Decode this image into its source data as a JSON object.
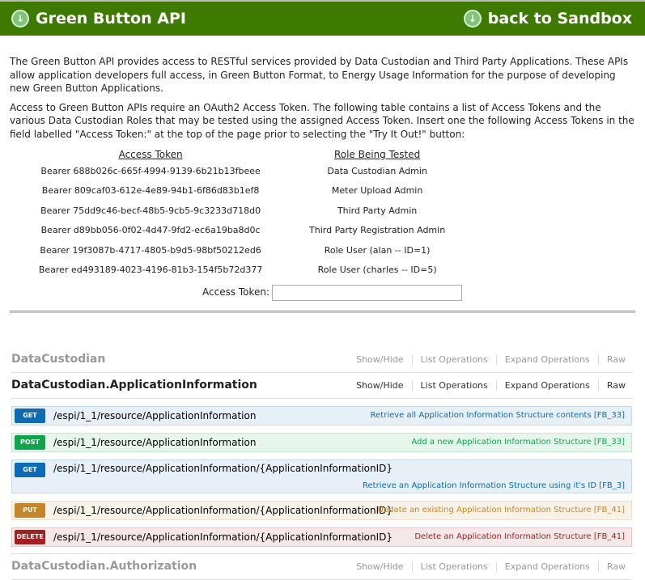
{
  "header": {
    "title": "Green Button API",
    "back_link": "back to Sandbox"
  },
  "intro": {
    "p1": "The Green Button API provides access to RESTful services provided by Data Custodian and Third Party Applications. These APIs allow application developers full access, in Green Button Format, to Energy Usage Information for the purpose of developing new Green Button Applications.",
    "p2": "Access to Green Button APIs require an OAuth2 Access Token. The following table contains a list of Access Tokens and the various Data Custodian Roles that may be tested using the assigned Access Token. Insert one the following Access Tokens in the field labelled \"Access Token:\" at the top of the page prior to selecting the \"Try It Out!\" button:"
  },
  "tokens": {
    "headers": [
      "Access Token",
      "Role Being Tested"
    ],
    "rows": [
      [
        "Bearer 688b026c-665f-4994-9139-6b21b13fbeee",
        "Data Custodian Admin"
      ],
      [
        "Bearer 809caf03-612e-4e89-94b1-6f86d83b1ef8",
        "Meter Upload Admin"
      ],
      [
        "Bearer 75dd9c46-becf-48b5-9cb5-9c3233d718d0",
        "Third Party Admin"
      ],
      [
        "Bearer d89bb056-0f02-4d47-9fd2-ec6a19ba8d0c",
        "Third Party Registration Admin"
      ],
      [
        "Bearer 19f3087b-4717-4805-b9d5-98bf50212ed6",
        "Role User (alan -- ID=1)"
      ],
      [
        "Bearer ed493189-4023-4196-81b3-154f5b72d377",
        "Role User (charles -- ID=5)"
      ]
    ],
    "input_label": "Access Token:",
    "input_value": ""
  },
  "links": [
    "Show/Hide",
    "List Operations",
    "Expand Operations",
    "Raw"
  ],
  "resources": [
    {
      "name": "DataCustodian"
    },
    {
      "name": "DataCustodian.ApplicationInformation",
      "ops": [
        {
          "method": "GET",
          "path": "/espi/1_1/resource/ApplicationInformation",
          "summary": "Retrieve all Application Information Structure contents [FB_33]"
        },
        {
          "method": "POST",
          "path": "/espi/1_1/resource/ApplicationInformation",
          "summary": "Add a new Application Information Structure [FB_33]"
        },
        {
          "method": "GET",
          "path": "/espi/1_1/resource/ApplicationInformation/{ApplicationInformationID}",
          "summary": "Retrieve an Application Information Structure using it's ID [FB_3]"
        },
        {
          "method": "PUT",
          "path": "/espi/1_1/resource/ApplicationInformation/{ApplicationInformationID}",
          "summary": "Update an existing Application Information Structure [FB_41]"
        },
        {
          "method": "DELETE",
          "path": "/espi/1_1/resource/ApplicationInformation/{ApplicationInformationID}",
          "summary": "Delete an Application Information Structure [FB_41]"
        }
      ]
    },
    {
      "name": "DataCustodian.Authorization"
    }
  ]
}
